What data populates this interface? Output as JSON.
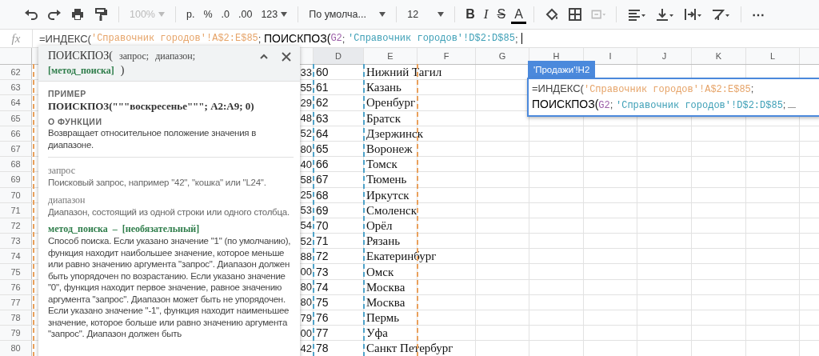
{
  "toolbar": {
    "zoom": {
      "value": "100%",
      "disabled": true
    },
    "currency": "р.",
    "percent": "%",
    "decrease_decimals": ".0",
    "increase_decimals": ".00",
    "number_format": "123",
    "font": "По умолча...",
    "font_size": "12",
    "bold": "B",
    "italic": "I",
    "strikethrough": "S",
    "text_color": "A",
    "merge_disabled": true,
    "more": "⋯"
  },
  "formula_bar": {
    "fx": "fx",
    "segments": [
      {
        "kind": "plain",
        "text": "=ИНДЕКС("
      },
      {
        "kind": "range",
        "text": "'Справочник городов'!A$2:E$85",
        "color": "#e6a469"
      },
      {
        "kind": "plain",
        "text": "; "
      },
      {
        "kind": "active",
        "text": "ПОИСКПОЗ("
      },
      {
        "kind": "range",
        "text": "G2",
        "color": "#9c5fa8"
      },
      {
        "kind": "plain",
        "text": "; "
      },
      {
        "kind": "range",
        "text": "'Справочник городов'!D$2:D$85",
        "color": "#3fa0b7"
      },
      {
        "kind": "plain",
        "text": ";"
      }
    ]
  },
  "column_headers": [
    "D",
    "E",
    "F",
    "G",
    "H",
    "I",
    "J",
    "K",
    "L"
  ],
  "rows": [
    {
      "number": "62",
      "c": "33",
      "d": "60",
      "e": "Нижний Тагил"
    },
    {
      "number": "63",
      "c": "55",
      "d": "61",
      "e": "Казань"
    },
    {
      "number": "64",
      "c": "29",
      "d": "62",
      "e": "Оренбург"
    },
    {
      "number": "65",
      "c": "48",
      "d": "63",
      "e": "Братск"
    },
    {
      "number": "66",
      "c": "52",
      "d": "64",
      "e": "Дзержинск"
    },
    {
      "number": "67",
      "c": "80",
      "d": "65",
      "e": "Воронеж"
    },
    {
      "number": "68",
      "c": "40",
      "d": "66",
      "e": "Томск"
    },
    {
      "number": "69",
      "c": "58",
      "d": "67",
      "e": "Тюмень"
    },
    {
      "number": "70",
      "c": "25",
      "d": "68",
      "e": "Иркутск"
    },
    {
      "number": "71",
      "c": "53",
      "d": "69",
      "e": "Смоленск"
    },
    {
      "number": "72",
      "c": "54",
      "d": "70",
      "e": "Орёл"
    },
    {
      "number": "73",
      "c": "52",
      "d": "71",
      "e": "Рязань"
    },
    {
      "number": "74",
      "c": "88",
      "d": "72",
      "e": "Екатеринбург"
    },
    {
      "number": "75",
      "c": "00",
      "d": "73",
      "e": "Омск"
    },
    {
      "number": "76",
      "c": "80",
      "d": "74",
      "e": "Москва"
    },
    {
      "number": "77",
      "c": "80",
      "d": "75",
      "e": "Москва"
    },
    {
      "number": "78",
      "c": "79",
      "d": "76",
      "e": "Пермь"
    },
    {
      "number": "79",
      "c": "00",
      "d": "77",
      "e": "Уфа"
    },
    {
      "number": "80",
      "c": "42",
      "d": "78",
      "e": "Санкт Петербург"
    }
  ],
  "cell_editor": {
    "label": "'Продажи'!H2",
    "lines": [
      [
        {
          "kind": "plain",
          "text": "=ИНДЕКС("
        },
        {
          "kind": "range",
          "text": "'Справочник городов'!A$2:E$85",
          "color": "#e6a469"
        },
        {
          "kind": "plain",
          "text": ";"
        }
      ],
      [
        {
          "kind": "active",
          "text": "ПОИСКПОЗ("
        },
        {
          "kind": "range",
          "text": "G2",
          "color": "#9c5fa8"
        },
        {
          "kind": "plain",
          "text": "; "
        },
        {
          "kind": "range",
          "text": "'Справочник городов'!D$2:D$85",
          "color": "#3fa0b7"
        },
        {
          "kind": "plain",
          "text": ";"
        }
      ]
    ]
  },
  "help_popup": {
    "signature": [
      {
        "kind": "name",
        "text": "ПОИСКПОЗ("
      },
      {
        "kind": "arg",
        "text": "запрос;"
      },
      {
        "kind": "arg",
        "text": "диапазон;"
      },
      {
        "kind": "optional",
        "text": "[метод_поиска]"
      },
      {
        "kind": "name",
        "text": ")"
      }
    ],
    "example_label": "ПРИМЕР",
    "example": "ПОИСКПОЗ(\"\"\"воскресенье\"\"\"; A2:A9; 0)",
    "about_label": "О ФУНКЦИИ",
    "about": "Возвращает относительное положение значения в диапазоне.",
    "arguments": [
      {
        "name": "запрос",
        "optional": false,
        "description": "Поисковый запрос, например \"42\", \"кошка\" или \"L24\"."
      },
      {
        "name": "диапазон",
        "optional": false,
        "description": "Диапазон, состоящий из одной строки или одного столбца."
      },
      {
        "name": "метод_поиска  –  [необязательный]",
        "optional": true,
        "description": "Способ поиска. Если указано значение \"1\" (по умолчанию), функция находит наибольшее значение, которое меньше или равно значению аргумента \"запрос\". Диапазон должен быть упорядочен по возрастанию. Если указано значение \"0\", функция находит первое значение, равное значению аргумента \"запрос\". Диапазон может быть не упорядочен. Если указано значение \"-1\", функция находит наименьшее значение, которое больше или равно значению аргумента \"запрос\". Диапазон должен быть"
      }
    ]
  }
}
